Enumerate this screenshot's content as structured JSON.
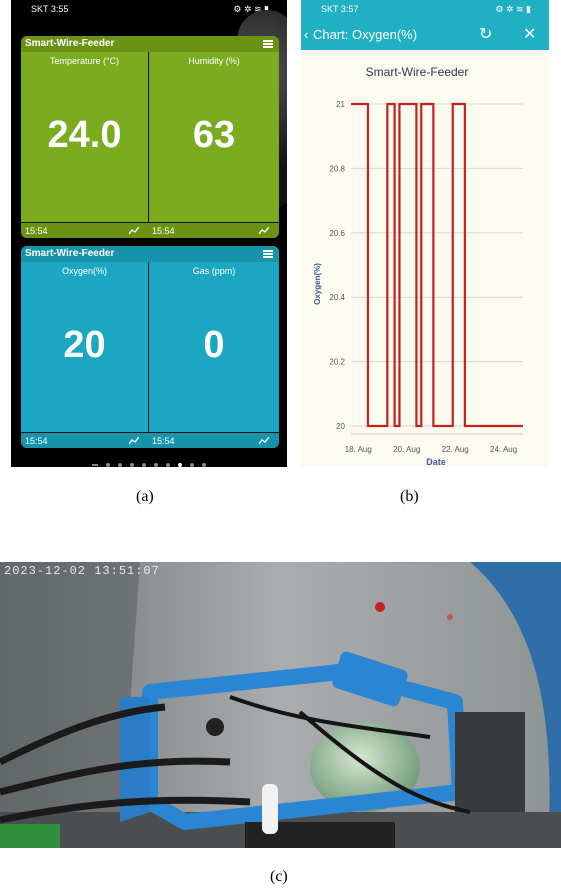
{
  "panel_a": {
    "status_time": "SKT 3:55",
    "widgets": [
      {
        "title": "Smart-Wire-Feeder",
        "cells": [
          {
            "label": "Temperature (°C)",
            "value": "24.0",
            "time": "15:54"
          },
          {
            "label": "Humidity (%)",
            "value": "63",
            "time": "15:54"
          }
        ]
      },
      {
        "title": "Smart-Wire-Feeder",
        "cells": [
          {
            "label": "Oxygen(%)",
            "value": "20",
            "time": "15:54"
          },
          {
            "label": "Gas (ppm)",
            "value": "0",
            "time": "15:54"
          }
        ]
      }
    ],
    "caption": "(a)"
  },
  "panel_b": {
    "status_time": "SKT 3:57",
    "appbar_title": "Chart: Oxygen(%)",
    "icons": {
      "back": "back-icon",
      "refresh": "refresh-icon",
      "close": "close-icon"
    },
    "caption": "(b)",
    "chart_data": {
      "type": "line",
      "title": "Smart-Wire-Feeder",
      "xlabel": "Date",
      "ylabel": "Oxygen(%)",
      "ylim": [
        20,
        21
      ],
      "yticks": [
        "20",
        "20.2",
        "20.4",
        "20.6",
        "20.8",
        "21"
      ],
      "xticks": [
        "18. Aug",
        "20. Aug",
        "22. Aug",
        "24. Aug"
      ],
      "xlim": [
        17.7,
        24.8
      ],
      "color": "#c62020",
      "series": [
        {
          "x": [
            17.7,
            18.4,
            18.4,
            19.2,
            19.2,
            19.5,
            19.5,
            19.7,
            19.7,
            20.4,
            20.4,
            20.6,
            20.6,
            21.1,
            21.1,
            21.9,
            21.9,
            22.4,
            22.4,
            23.3,
            23.3,
            24.8
          ],
          "y": [
            21,
            21,
            20,
            20,
            21,
            21,
            20,
            20,
            21,
            21,
            20,
            20,
            21,
            21,
            20,
            20,
            21,
            21,
            20,
            20,
            20,
            20
          ]
        }
      ]
    }
  },
  "panel_c": {
    "timestamp": "2023-12-02 13:51:07",
    "caption": "(c)"
  }
}
